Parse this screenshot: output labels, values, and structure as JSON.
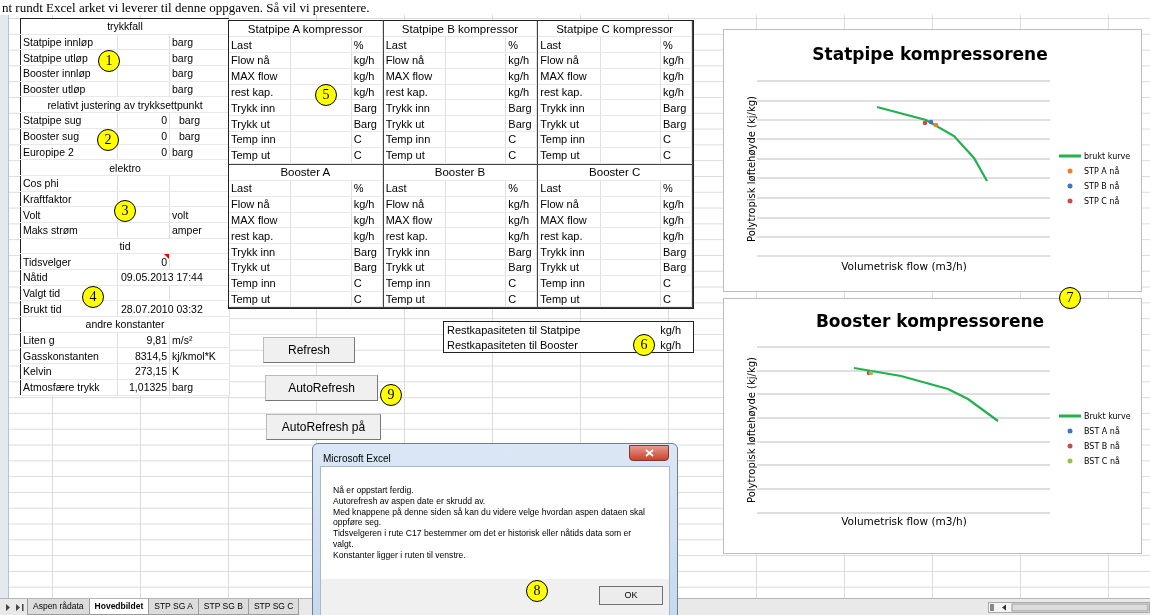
{
  "document_text": "nt rundt Excel arket vi leverer til denne oppgaven. Så vil vi presentere.",
  "parameter_sections": [
    {
      "title": "trykkfall",
      "rows": [
        {
          "label": "Statpipe innløp",
          "unit": "barg"
        },
        {
          "label": "Statpipe utløp",
          "unit": "barg"
        },
        {
          "label": "Booster innløp",
          "unit": "barg"
        },
        {
          "label": "Booster utløp",
          "unit": "barg"
        }
      ]
    },
    {
      "title": "relativt justering av trykksettpunkt",
      "rows": [
        {
          "label": "Statpipe sug",
          "value": "0",
          "unit": "barg"
        },
        {
          "label": "Booster sug",
          "value": "0",
          "unit": "barg"
        },
        {
          "label": "Europipe 2",
          "value": "0",
          "unit": "barg"
        }
      ]
    },
    {
      "title": "elektro",
      "rows": [
        {
          "label": "Cos phi"
        },
        {
          "label": "Kraftfaktor"
        },
        {
          "label": "Volt",
          "unit": "volt"
        },
        {
          "label": "Maks strøm",
          "unit": "amper"
        }
      ]
    },
    {
      "title": "tid",
      "rows": [
        {
          "label": "Tidsvelger",
          "value": "0",
          "comment": true
        },
        {
          "label": "Nåtid",
          "value": "09.05.2013 17:44"
        },
        {
          "label": "Valgt tid"
        },
        {
          "label": "Brukt tid",
          "value": "28.07.2010 03:32"
        }
      ]
    },
    {
      "title": "andre konstanter",
      "rows": [
        {
          "label": "Liten g",
          "value": "9,81",
          "unit": "m/s²"
        },
        {
          "label": "Gasskonstanten",
          "value": "8314,5",
          "unit": "kj/kmol*K"
        },
        {
          "label": "Kelvin",
          "value": "273,15",
          "unit": "K"
        },
        {
          "label": "Atmosfære trykk",
          "value": "1,01325",
          "unit": "barg"
        }
      ]
    }
  ],
  "compressors": [
    {
      "title": "Statpipe A kompressor",
      "rows": [
        {
          "label": "Last",
          "unit": "%"
        },
        {
          "label": "Flow nå",
          "unit": "kg/h"
        },
        {
          "label": "MAX flow",
          "unit": "kg/h"
        },
        {
          "label": "rest kap.",
          "unit": "kg/h"
        },
        {
          "label": "Trykk inn",
          "unit": "Barg"
        },
        {
          "label": "Trykk ut",
          "unit": "Barg"
        },
        {
          "label": "Temp inn",
          "unit": "C"
        },
        {
          "label": "Temp ut",
          "unit": "C"
        }
      ]
    },
    {
      "title": "Statpipe B kompressor",
      "rows": [
        {
          "label": "Last",
          "unit": "%"
        },
        {
          "label": "Flow nå",
          "unit": "kg/h"
        },
        {
          "label": "MAX flow",
          "unit": "kg/h"
        },
        {
          "label": "rest kap.",
          "unit": "kg/h"
        },
        {
          "label": "Trykk inn",
          "unit": "Barg"
        },
        {
          "label": "Trykk ut",
          "unit": "Barg"
        },
        {
          "label": "Temp inn",
          "unit": "C"
        },
        {
          "label": "Temp ut",
          "unit": "C"
        }
      ]
    },
    {
      "title": "Statpipe C kompressor",
      "rows": [
        {
          "label": "Last",
          "unit": "%"
        },
        {
          "label": "Flow nå",
          "unit": "kg/h"
        },
        {
          "label": "MAX flow",
          "unit": "kg/h"
        },
        {
          "label": "rest kap.",
          "unit": "kg/h"
        },
        {
          "label": "Trykk inn",
          "unit": "Barg"
        },
        {
          "label": "Trykk ut",
          "unit": "Barg"
        },
        {
          "label": "Temp inn",
          "unit": "C"
        },
        {
          "label": "Temp ut",
          "unit": "C"
        }
      ]
    },
    {
      "title": "Booster A",
      "rows": [
        {
          "label": "Last",
          "unit": "%"
        },
        {
          "label": "Flow nå",
          "unit": "kg/h"
        },
        {
          "label": "MAX flow",
          "unit": "kg/h"
        },
        {
          "label": "rest kap.",
          "unit": "kg/h"
        },
        {
          "label": "Trykk inn",
          "unit": "Barg"
        },
        {
          "label": "Trykk ut",
          "unit": "Barg"
        },
        {
          "label": "Temp inn",
          "unit": "C"
        },
        {
          "label": "Temp ut",
          "unit": "C"
        }
      ]
    },
    {
      "title": "Booster B",
      "rows": [
        {
          "label": "Last",
          "unit": "%"
        },
        {
          "label": "Flow nå",
          "unit": "kg/h"
        },
        {
          "label": "MAX flow",
          "unit": "kg/h"
        },
        {
          "label": "rest kap.",
          "unit": "kg/h"
        },
        {
          "label": "Trykk inn",
          "unit": "Barg"
        },
        {
          "label": "Trykk ut",
          "unit": "Barg"
        },
        {
          "label": "Temp inn",
          "unit": "C"
        },
        {
          "label": "Temp ut",
          "unit": "C"
        }
      ]
    },
    {
      "title": "Booster C",
      "rows": [
        {
          "label": "Last",
          "unit": "%"
        },
        {
          "label": "Flow nå",
          "unit": "kg/h"
        },
        {
          "label": "MAX flow",
          "unit": "kg/h"
        },
        {
          "label": "rest kap.",
          "unit": "kg/h"
        },
        {
          "label": "Trykk inn",
          "unit": "Barg"
        },
        {
          "label": "Trykk ut",
          "unit": "Barg"
        },
        {
          "label": "Temp inn",
          "unit": "C"
        },
        {
          "label": "Temp ut",
          "unit": "C"
        }
      ]
    }
  ],
  "capacity": [
    {
      "label": "Restkapasiteten til Statpipe",
      "unit": "kg/h"
    },
    {
      "label": "Restkapasiteten til Booster",
      "unit": "kg/h"
    }
  ],
  "buttons": [
    "Refresh",
    "AutoRefresh",
    "AutoRefresh på"
  ],
  "charts": [
    {
      "title": "Statpipe kompressorene",
      "xlabel": "Volumetrisk flow (m3/h)",
      "ylabel": "Polytropisk løftehøyde (kj/kg)",
      "legend": [
        {
          "label": "brukt kurve",
          "kind": "line",
          "color": "#22b14c"
        },
        {
          "label": "STP A nå",
          "kind": "marker",
          "color": "#ed7d31"
        },
        {
          "label": "STP B nå",
          "kind": "marker",
          "color": "#4472c4"
        },
        {
          "label": "STP C nå",
          "kind": "marker",
          "color": "#c0504d"
        }
      ]
    },
    {
      "title": "Booster kompressorene",
      "xlabel": "Volumetrisk flow (m3/h)",
      "ylabel": "Polytropisk løftehøyde (kj/kg)",
      "legend": [
        {
          "label": "Brukt kurve",
          "kind": "line",
          "color": "#22b14c"
        },
        {
          "label": "BST A nå",
          "kind": "marker",
          "color": "#4472c4"
        },
        {
          "label": "BST B nå",
          "kind": "marker",
          "color": "#c0504d"
        },
        {
          "label": "BST C nå",
          "kind": "marker",
          "color": "#9bbb59"
        }
      ]
    }
  ],
  "dialog": {
    "title": "Microsoft Excel",
    "message": [
      "Nå er oppstart ferdig.",
      "Autorefresh av aspen date er skrudd av.",
      "Med knappene på denne siden så kan du videre velge hvordan aspen dataen skal oppføre seg.",
      "Tidsvelgeren i rute C17 bestemmer om det er historisk eller nåtids data som er valgt.",
      "Konstanter ligger i ruten til venstre."
    ],
    "button": "OK"
  },
  "sheet_tabs": [
    {
      "label": "Aspen rådata",
      "selected": false
    },
    {
      "label": "Hovedbildet",
      "selected": true
    },
    {
      "label": "STP SG A",
      "selected": false
    },
    {
      "label": "STP SG B",
      "selected": false
    },
    {
      "label": "STP SG C",
      "selected": false
    }
  ],
  "callouts": [
    "1",
    "2",
    "3",
    "4",
    "5",
    "6",
    "7",
    "8",
    "9"
  ]
}
